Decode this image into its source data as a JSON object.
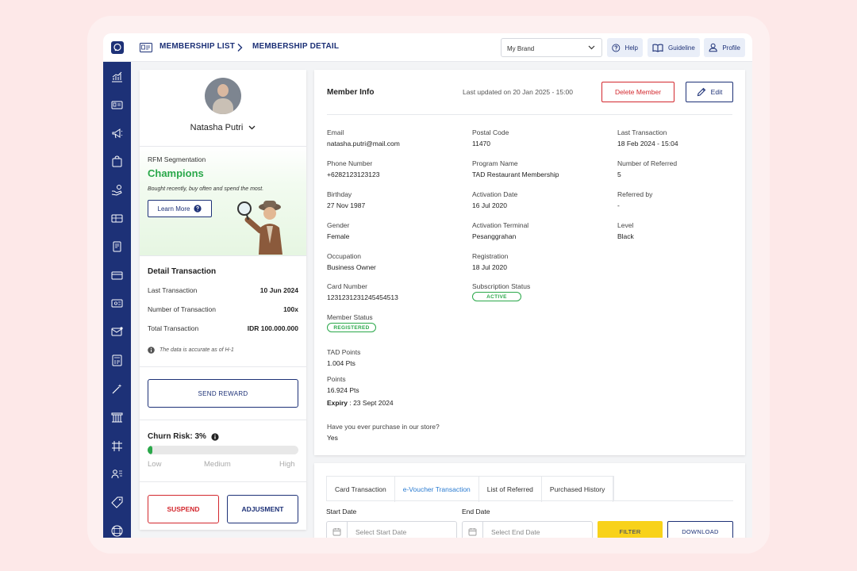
{
  "breadcrumb": {
    "list": "MEMBERSHIP LIST",
    "detail": "MEMBERSHIP DETAIL"
  },
  "topbar": {
    "brand_select": "My Brand",
    "help": "Help",
    "guideline": "Guideline",
    "profile": "Profile"
  },
  "sidebar": {
    "icons": [
      "chart-icon",
      "id-card-icon",
      "megaphone-icon",
      "shopping-bag-icon",
      "hand-coin-icon",
      "gift-card-icon",
      "document-icon",
      "credit-card-icon",
      "voucher-icon",
      "mail-icon",
      "receipt-icon",
      "magic-wand-icon",
      "building-icon",
      "grid-icon",
      "user-group-icon",
      "tag-icon",
      "grid-icon"
    ]
  },
  "member": {
    "name": "Natasha Putri",
    "rfm_label": "RFM Segmentation",
    "rfm_value": "Champions",
    "rfm_desc": "Bought recently, buy often and spend the most.",
    "learn_more": "Learn More"
  },
  "detail_transaction": {
    "title": "Detail Transaction",
    "rows": [
      {
        "label": "Last Transaction",
        "value": "10 Jun 2024"
      },
      {
        "label": "Number of Transaction",
        "value": "100x"
      },
      {
        "label": "Total Transaction",
        "value": "IDR 100.000.000"
      }
    ],
    "note": "The data is accurate as of H-1"
  },
  "send_reward": "SEND REWARD",
  "churn": {
    "title": "Churn Risk: 3%",
    "level_percent": 3,
    "low": "Low",
    "medium": "Medium",
    "high": "High"
  },
  "actions": {
    "suspend": "SUSPEND",
    "adjustment": "ADJUSMENT"
  },
  "info": {
    "title": "Member Info",
    "updated": "Last updated on 20 Jan 2025 - 15:00",
    "delete": "Delete Member",
    "edit": "Edit",
    "col1": [
      {
        "label": "Email",
        "value": "natasha.putri@mail.com"
      },
      {
        "label": "Phone Number",
        "value": "+6282123123123"
      },
      {
        "label": "Birthday",
        "value": "27 Nov 1987"
      },
      {
        "label": "Gender",
        "value": "Female"
      },
      {
        "label": "Occupation",
        "value": "Business Owner"
      },
      {
        "label": "Card Number",
        "value": "1231231231245454513"
      }
    ],
    "member_status_label": "Member Status",
    "member_status": "REGISTERED",
    "tad_points_label": "TAD Points",
    "tad_points": "1.004 Pts",
    "points_label": "Points",
    "points": "16.924 Pts",
    "expiry_label": "Expiry",
    "expiry": " : 23 Sept 2024",
    "purchase_q": "Have you ever purchase in our store?",
    "purchase_a": "Yes",
    "col2": [
      {
        "label": "Postal Code",
        "value": "11470"
      },
      {
        "label": "Program Name",
        "value": "TAD Restaurant Membership"
      },
      {
        "label": "Activation Date",
        "value": "16 Jul 2020"
      },
      {
        "label": "Activation Terminal",
        "value": "Pesanggrahan"
      },
      {
        "label": "Registration",
        "value": "18 Jul 2020"
      }
    ],
    "subscription_label": "Subscription Status",
    "subscription": "ACTIVE",
    "col3": [
      {
        "label": "Last Transaction",
        "value": "18 Feb 2024 - 15:04"
      },
      {
        "label": "Number of Referred",
        "value": "5"
      },
      {
        "label": "Referred by",
        "value": "-"
      },
      {
        "label": "Level",
        "value": "Black"
      }
    ]
  },
  "history": {
    "tabs": [
      "Card Transaction",
      "e-Voucher Transaction",
      "List of Referred",
      "Purchased History"
    ],
    "active_tab": 1,
    "start_label": "Start Date",
    "start_placeholder": "Select Start Date",
    "end_label": "End Date",
    "end_placeholder": "Select End Date",
    "filter": "FILTER",
    "download": "DOWNLOAD"
  },
  "colors": {
    "primary": "#1d3177",
    "success": "#2aa84a",
    "danger": "#d3282e",
    "accent_yellow": "#f8d21a",
    "tab_active": "#2a7bd1"
  }
}
